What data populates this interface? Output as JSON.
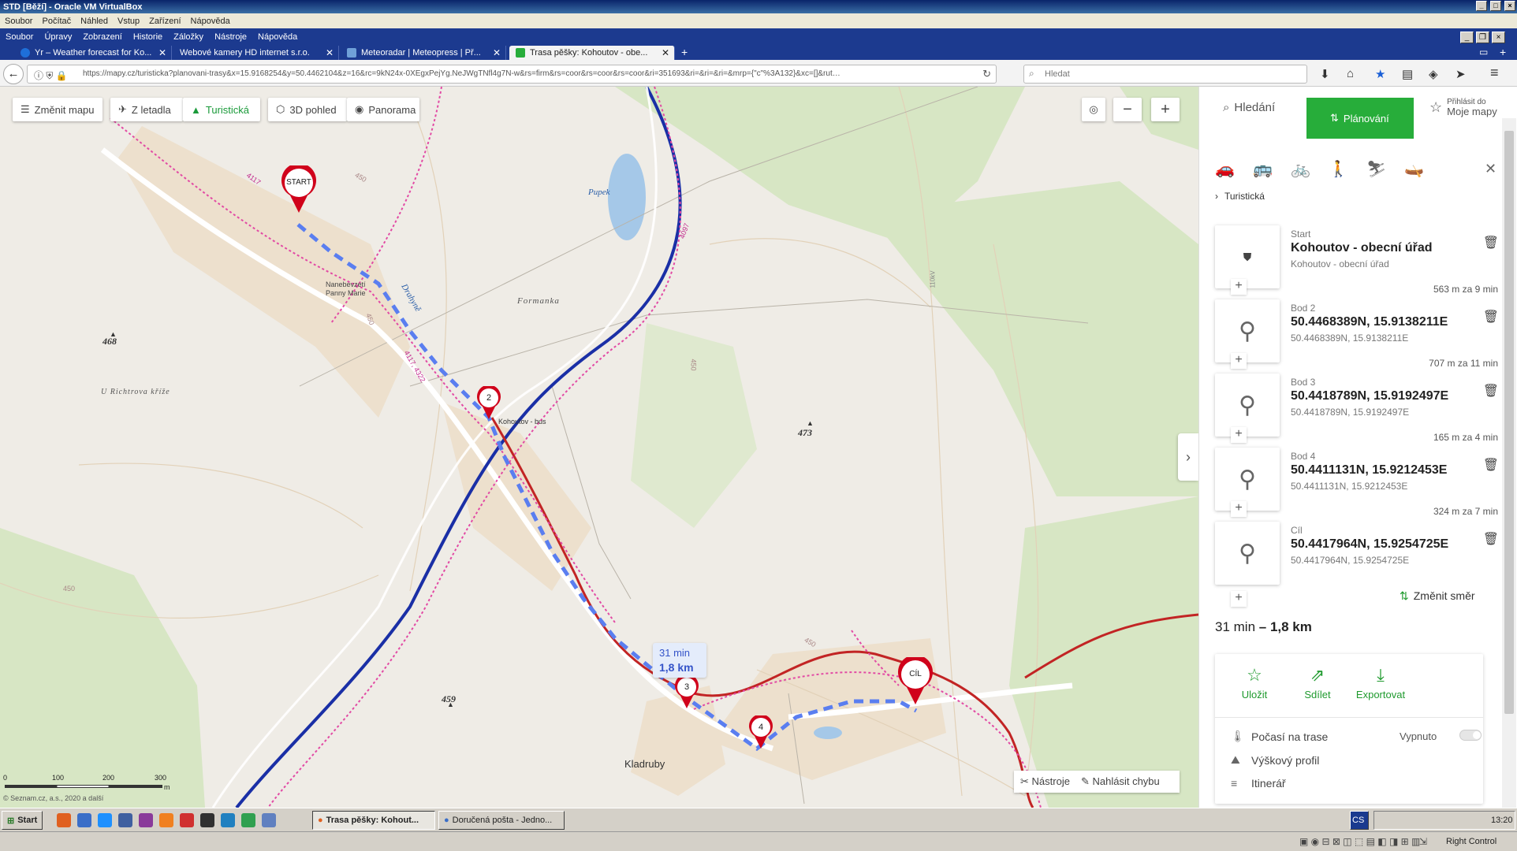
{
  "vbox": {
    "title": "STD [Běží] - Oracle VM VirtualBox",
    "menu": [
      "Soubor",
      "Počítač",
      "Náhled",
      "Vstup",
      "Zařízení",
      "Nápověda"
    ]
  },
  "firefox": {
    "menu": [
      "Soubor",
      "Úpravy",
      "Zobrazení",
      "Historie",
      "Záložky",
      "Nástroje",
      "Nápověda"
    ],
    "tabs": [
      {
        "label": "Yr – Weather forecast for Ko...",
        "color": "#1e6fd9"
      },
      {
        "label": "Webové kamery HD internet s.r.o.",
        "color": "#1c3a8f"
      },
      {
        "label": "Meteoradar | Meteopress | Př...",
        "color": "#3b6fb0"
      },
      {
        "label": "Trasa pěšky: Kohoutov - obe...",
        "color": "#27ad3a"
      }
    ],
    "url": "https://mapy.cz/turisticka?planovani-trasy&x=15.9168254&y=50.4462104&z=16&rc=9kN24x-0XEgxPejYg.NeJWgTNfl4g7N-w&rs=firm&rs=coor&rs=coor&rs=coor&ri=351693&ri=&ri=&ri=&mrp={\"c\"%3A132}&xc=[]&rut…",
    "search_placeholder": "Hledat"
  },
  "map": {
    "buttons": {
      "change": "Změnit mapu",
      "aerial": "Z letadla",
      "tourist": "Turistická",
      "view3d": "3D pohled",
      "panorama": "Panorama"
    },
    "labels": {
      "pupek": "Pupek",
      "formanka": "Formanka",
      "richtrova": "U Richtrova kříže",
      "kladruby": "Kladruby",
      "bus": "Kohoutov - bus",
      "church": "Nanebevzetí Panny Marie",
      "drahyne": "Drahyně",
      "e468": "468",
      "e473": "473",
      "e459": "459",
      "h450a": "450",
      "h450b": "450",
      "h450c": "450",
      "h450d": "450",
      "h450e": "450",
      "r4117": "4117",
      "r4097": "4097",
      "r4322": "4117, 4322",
      "kv110": "110kV"
    },
    "markers": {
      "start": "START",
      "m2": "2",
      "m3": "3",
      "m4": "4",
      "cil": "CÍL"
    },
    "tooltip": {
      "time": "31 min",
      "dist": "1,8 km"
    },
    "scale": {
      "s0": "0",
      "s100": "100",
      "s200": "200",
      "s300": "300",
      "unit": "m"
    },
    "copyright": "© Seznam.cz, a.s., 2020 a další",
    "tools": "Nástroje",
    "report": "Nahlásit chybu"
  },
  "panel": {
    "tab_search": "Hledání",
    "tab_plan": "Plánování",
    "tab_mymaps_small": "Přihlásit do",
    "tab_mymaps": "Moje mapy",
    "mode": "Turistická",
    "waypoints": [
      {
        "label": "Start",
        "name": "Kohoutov - obecní úřad",
        "sub": "Kohoutov - obecní úřad",
        "dist": "563 m za 9 min"
      },
      {
        "label": "Bod 2",
        "name": "50.4468389N, 15.9138211E",
        "sub": "50.4468389N, 15.9138211E",
        "dist": "707 m za 11 min"
      },
      {
        "label": "Bod 3",
        "name": "50.4418789N, 15.9192497E",
        "sub": "50.4418789N, 15.9192497E",
        "dist": "165 m za 4 min"
      },
      {
        "label": "Bod 4",
        "name": "50.4411131N, 15.9212453E",
        "sub": "50.4411131N, 15.9212453E",
        "dist": "324 m za 7 min"
      },
      {
        "label": "Cíl",
        "name": "50.4417964N, 15.9254725E",
        "sub": "50.4417964N, 15.9254725E",
        "dist": ""
      }
    ],
    "reverse": "Změnit směr",
    "summary_time": "31 min",
    "summary_dist": "– 1,8 km",
    "save": "Uložit",
    "share": "Sdílet",
    "export": "Exportovat",
    "weather": "Počasí na trase",
    "weather_state": "Vypnuto",
    "profile": "Výškový profil",
    "itinerary": "Itinerář"
  },
  "taskbar": {
    "start": "Start",
    "task1": "Trasa pěšky: Kohout...",
    "task2": "Doručená pošta - Jedno...",
    "lang": "CS",
    "clock": "13:20",
    "host_key": "Right Control"
  }
}
